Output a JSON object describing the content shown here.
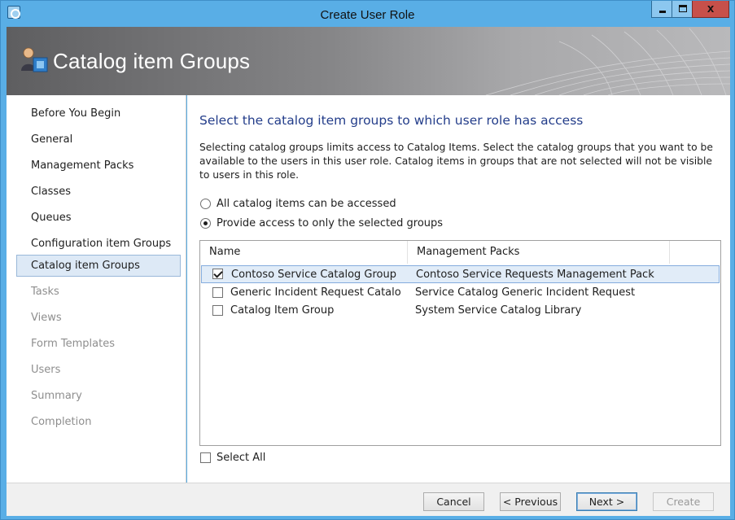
{
  "window": {
    "title": "Create User Role"
  },
  "banner": {
    "title": "Catalog item Groups"
  },
  "nav": {
    "items": [
      {
        "label": "Before You Begin",
        "state": "enabled"
      },
      {
        "label": "General",
        "state": "enabled"
      },
      {
        "label": "Management Packs",
        "state": "enabled"
      },
      {
        "label": "Classes",
        "state": "enabled"
      },
      {
        "label": "Queues",
        "state": "enabled"
      },
      {
        "label": "Configuration item Groups",
        "state": "enabled"
      },
      {
        "label": "Catalog item Groups",
        "state": "selected"
      },
      {
        "label": "Tasks",
        "state": "disabled"
      },
      {
        "label": "Views",
        "state": "disabled"
      },
      {
        "label": "Form Templates",
        "state": "disabled"
      },
      {
        "label": "Users",
        "state": "disabled"
      },
      {
        "label": "Summary",
        "state": "disabled"
      },
      {
        "label": "Completion",
        "state": "disabled"
      }
    ]
  },
  "main": {
    "heading": "Select the catalog item groups to which user role has access",
    "description": "Selecting catalog groups limits access to Catalog Items. Select the catalog groups that you want to be available to the users in this user role. Catalog items in groups that are not selected will not be visible to users in this role.",
    "radio_all": {
      "label": "All catalog items can be accessed",
      "checked": false
    },
    "radio_selected": {
      "label": "Provide access to only the selected groups",
      "checked": true
    },
    "columns": [
      "Name",
      "Management Packs"
    ],
    "rows": [
      {
        "name": "Contoso Service Catalog Group",
        "mp": "Contoso Service Requests Management Pack",
        "checked": true,
        "selected": true
      },
      {
        "name": "Generic Incident Request Catalo",
        "mp": "Service Catalog Generic Incident Request",
        "checked": false,
        "selected": false
      },
      {
        "name": "Catalog Item Group",
        "mp": "System Service Catalog Library",
        "checked": false,
        "selected": false
      }
    ],
    "select_all": {
      "label": "Select All",
      "checked": false
    }
  },
  "footer": {
    "cancel": "Cancel",
    "previous": "< Previous",
    "next": "Next >",
    "create": "Create"
  },
  "colors": {
    "heading": "#233d8a",
    "accent": "#59aee6",
    "selection": "#dde9f6",
    "close_button": "#c7504a"
  },
  "icons": [
    "app-icon",
    "minimize-icon",
    "maximize-icon",
    "close-icon",
    "user-role-icon"
  ]
}
